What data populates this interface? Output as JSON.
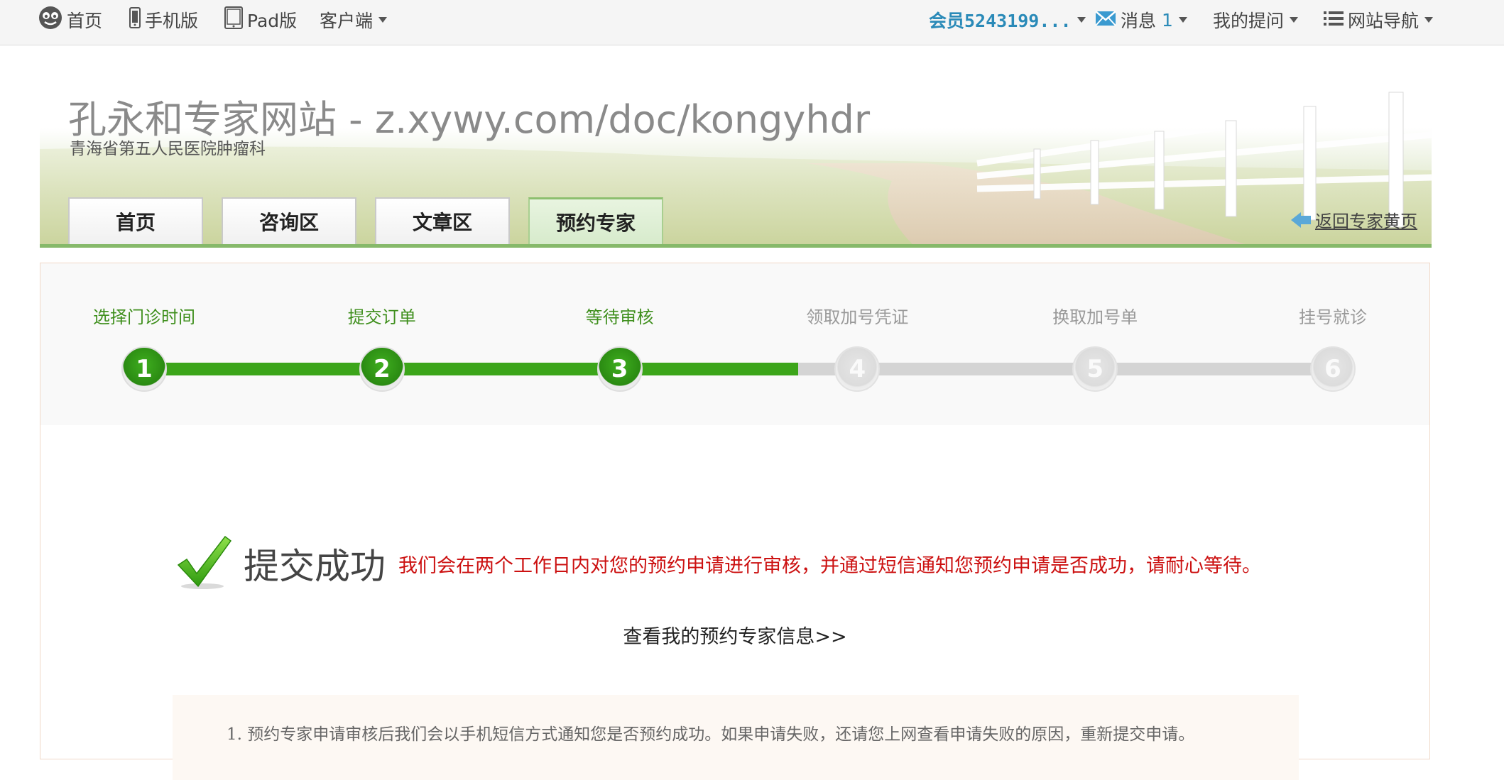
{
  "topbar": {
    "home": "首页",
    "mobile": "手机版",
    "pad": "Pad版",
    "client": "客户端",
    "member": "会员5243199...",
    "messages_label": "消息",
    "messages_count": "1",
    "my_questions": "我的提问",
    "site_nav": "网站导航"
  },
  "banner": {
    "title": "孔永和专家网站 - z.xywy.com/doc/kongyhdr",
    "subtitle": "青海省第五人民医院肿瘤科",
    "tabs": [
      {
        "label": "首页"
      },
      {
        "label": "咨询区"
      },
      {
        "label": "文章区"
      },
      {
        "label": "预约专家"
      }
    ],
    "active_tab": "预约专家",
    "back_link": "返回专家黄页"
  },
  "steps": {
    "current": 3,
    "progress_fraction": 0.55,
    "items": [
      {
        "num": "1",
        "label": "选择门诊时间"
      },
      {
        "num": "2",
        "label": "提交订单"
      },
      {
        "num": "3",
        "label": "等待审核"
      },
      {
        "num": "4",
        "label": "领取加号凭证"
      },
      {
        "num": "5",
        "label": "换取加号单"
      },
      {
        "num": "6",
        "label": "挂号就诊"
      }
    ]
  },
  "success": {
    "title": "提交成功",
    "message": "我们会在两个工作日内对您的预约申请进行审核，并通过短信通知您预约申请是否成功，请耐心等待。",
    "view_link": "查看我的预约专家信息>>"
  },
  "notes": [
    "1. 预约专家申请审核后我们会以手机短信方式通知您是否预约成功。如果申请失败，还请您上网查看申请失败的原因，重新提交申请。"
  ],
  "colors": {
    "accent_green": "#3ca51a",
    "alert_red": "#cc1111",
    "link_blue": "#2a8ab8"
  }
}
